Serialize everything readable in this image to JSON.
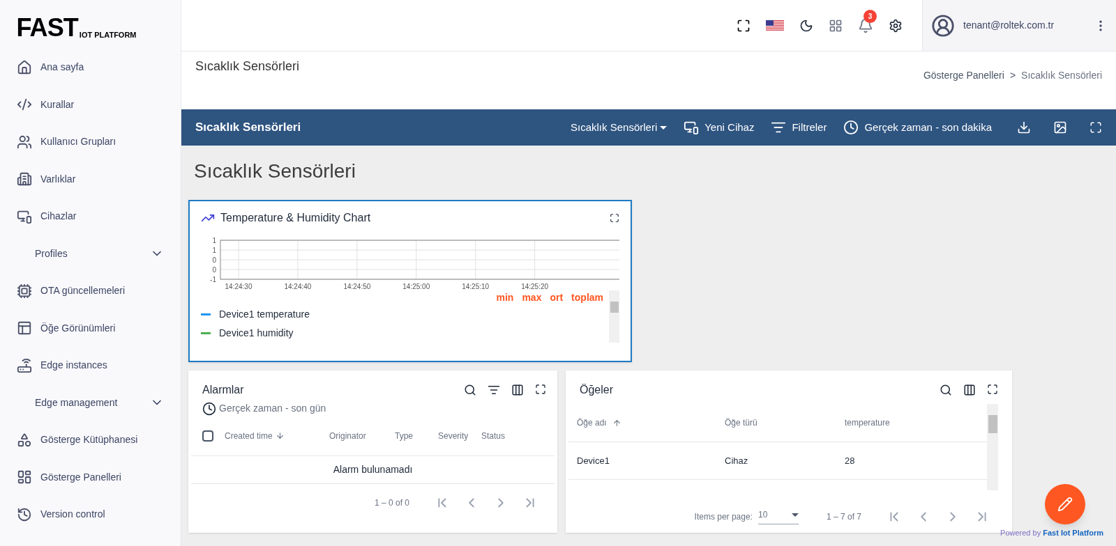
{
  "logo": {
    "main": "FAST",
    "sub": "IOT PLATFORM"
  },
  "sidebar": {
    "items": [
      {
        "kind": "item",
        "label": "Ana sayfa"
      },
      {
        "kind": "item",
        "label": "Kurallar"
      },
      {
        "kind": "item",
        "label": "Kullanıcı Grupları"
      },
      {
        "kind": "item",
        "label": "Varlıklar"
      },
      {
        "kind": "item",
        "label": "Cihazlar"
      },
      {
        "kind": "group",
        "label": "Profiles",
        "expanded": false
      },
      {
        "kind": "item",
        "label": "OTA güncellemeleri"
      },
      {
        "kind": "item",
        "label": "Öğe Görünümleri"
      },
      {
        "kind": "item",
        "label": "Edge instances"
      },
      {
        "kind": "group",
        "label": "Edge management",
        "expanded": false
      },
      {
        "kind": "item",
        "label": "Gösterge Kütüphanesi"
      },
      {
        "kind": "item",
        "label": "Gösterge Panelleri"
      },
      {
        "kind": "item",
        "label": "Version control"
      }
    ]
  },
  "topbar": {
    "notification_count": "3",
    "user": "tenant@roltek.com.tr"
  },
  "page_title": "Sıcaklık Sensörleri",
  "breadcrumb": {
    "items": [
      "Gösterge Panelleri",
      "Sıcaklık Sensörleri"
    ],
    "separator": ">"
  },
  "toolbar": {
    "title": "Sıcaklık Sensörleri",
    "dashboard_select": "Sıcaklık Sensörleri",
    "buttons": [
      {
        "kind": "device",
        "label": "Yeni Cihaz"
      },
      {
        "kind": "filter",
        "label": "Filtreler"
      },
      {
        "kind": "clock",
        "label": "Gerçek zaman - son dakika"
      }
    ]
  },
  "dashboard_title": "Sıcaklık Sensörleri",
  "chart_widget": {
    "title": "Temperature & Humidity Chart",
    "chart_data": {
      "type": "line",
      "categories": [
        "14:24:30",
        "14:24:40",
        "14:24:50",
        "14:25:00",
        "14:25:10",
        "14:25:20"
      ],
      "ylim": [
        -1,
        1
      ],
      "grid": true,
      "yticks": [
        {
          "value": 1,
          "label": "1"
        },
        {
          "value": 0.5,
          "label": "1"
        },
        {
          "value": 0,
          "label": "0"
        },
        {
          "value": -0.5,
          "label": "0"
        },
        {
          "value": -1,
          "label": "-1"
        }
      ]
    },
    "stat_headers": [
      "min",
      "max",
      "ort",
      "toplam"
    ],
    "legend": [
      {
        "name": "Device1 temperature",
        "color": "#2196f3"
      },
      {
        "name": "Device1 humidity",
        "color": "#4caf50"
      }
    ]
  },
  "alarms": {
    "title": "Alarmlar",
    "timewindow": "Gerçek zaman - son gün",
    "select_all_checked": false,
    "columns": [
      {
        "label": "Created time",
        "kind": "sorted-descending"
      },
      {
        "label": "Originator",
        "kind": "plain"
      },
      {
        "label": "Type",
        "kind": "plain"
      },
      {
        "label": "Severity",
        "kind": "plain"
      },
      {
        "label": "Status",
        "kind": "plain"
      }
    ],
    "empty_message": "Alarm bulunamadı",
    "range": "1 – 0 of 0"
  },
  "entities": {
    "title": "Öğeler",
    "columns": [
      {
        "label": "Öğe adı",
        "kind": "sorted-ascending"
      },
      {
        "label": "Öğe türü",
        "kind": "plain"
      },
      {
        "label": "temperature",
        "kind": "plain"
      }
    ],
    "rows": [
      [
        "Device1",
        "Cihaz",
        "28"
      ]
    ],
    "items_per_page_label": "Items per page:",
    "page_size": "10",
    "range": "1 – 7 of 7"
  },
  "footer": {
    "powered_by": "Powered by",
    "brand": "Fast Iot Platform"
  }
}
